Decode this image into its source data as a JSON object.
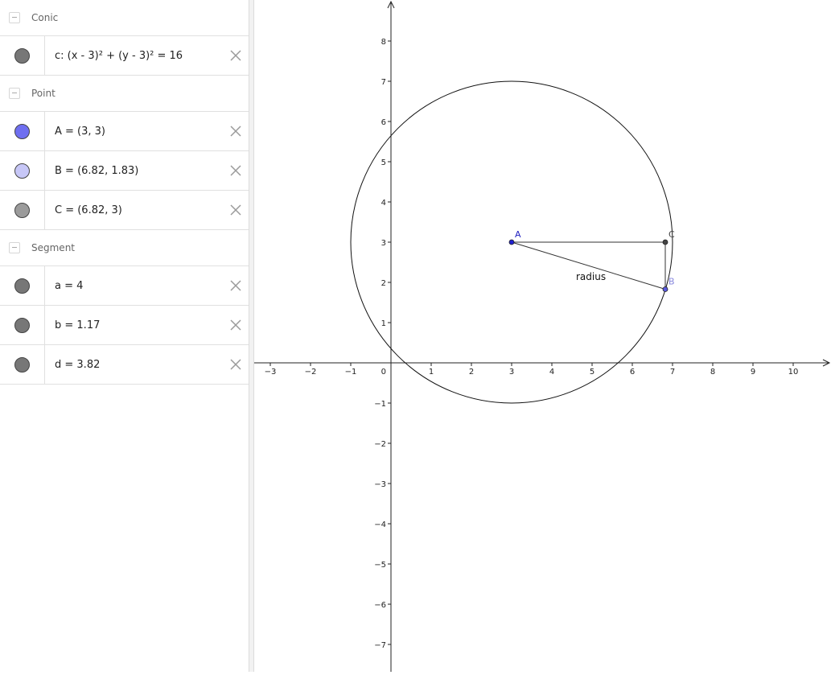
{
  "algebra": {
    "groups": [
      {
        "label": "Conic",
        "items": [
          {
            "text": "c: (x - 3)² + (y - 3)² = 16",
            "color": "#777777"
          }
        ]
      },
      {
        "label": "Point",
        "items": [
          {
            "text": "A = (3, 3)",
            "color": "#6f6ff0"
          },
          {
            "text": "B = (6.82, 1.83)",
            "color": "#c7c7f7"
          },
          {
            "text": "C = (6.82, 3)",
            "color": "#9b9b9b"
          }
        ]
      },
      {
        "label": "Segment",
        "items": [
          {
            "text": "a = 4",
            "color": "#777777"
          },
          {
            "text": "b = 1.17",
            "color": "#777777"
          },
          {
            "text": "d = 3.82",
            "color": "#777777"
          }
        ]
      }
    ]
  },
  "graphics": {
    "x_ticks": [
      -3,
      -2,
      -1,
      1,
      2,
      3,
      4,
      5,
      6,
      7,
      8,
      9,
      10
    ],
    "y_ticks": [
      8,
      7,
      6,
      5,
      4,
      3,
      2,
      1,
      -1,
      -2,
      -3,
      -4,
      -5,
      -6,
      -7
    ],
    "origin_label": "0",
    "circle": {
      "name": "c",
      "center": [
        3,
        3
      ],
      "radius": 4
    },
    "points": [
      {
        "name": "A",
        "label": "A",
        "x": 3,
        "y": 3,
        "fill": "#2020d0",
        "label_color": "#2020c0"
      },
      {
        "name": "B",
        "label": "B",
        "x": 6.82,
        "y": 1.83,
        "fill": "#5a5ae0",
        "label_color": "#8888dd"
      },
      {
        "name": "C",
        "label": "C",
        "x": 6.82,
        "y": 3,
        "fill": "#444444",
        "label_color": "#444444"
      }
    ],
    "segments": [
      {
        "name": "a",
        "from": "A",
        "to": "B"
      },
      {
        "name": "b",
        "from": "B",
        "to": "C"
      },
      {
        "name": "d",
        "from": "A",
        "to": "C"
      }
    ],
    "segment_caption": {
      "text": "radius",
      "x": 4.6,
      "y": 2.1
    }
  }
}
